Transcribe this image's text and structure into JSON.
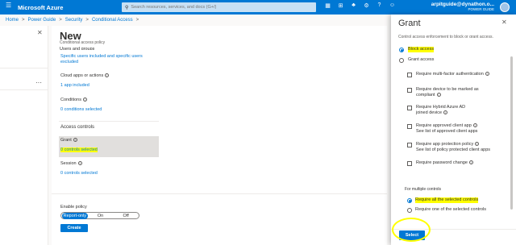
{
  "topbar": {
    "brand": "Microsoft Azure",
    "search_placeholder": "Search resources, services, and docs (G+/)",
    "user_name": "arpitguide@dynathon.o...",
    "user_dir": "POWER GUIDE"
  },
  "breadcrumb": [
    "Home",
    "Power Guide",
    "Security",
    "Conditional Access"
  ],
  "new_panel": {
    "title": "New",
    "subtitle": "Conditional access policy",
    "users_link": "Specific users included and specific users excluded",
    "cloud_apps_label": "Cloud apps or actions",
    "cloud_apps_value": "1 app included",
    "conditions_label": "Conditions",
    "conditions_value": "0 conditions selected",
    "access_controls_heading": "Access controls",
    "grant_label": "Grant",
    "grant_value": "0 controls selected",
    "session_label": "Session",
    "session_value": "0 controls selected",
    "enable_policy_label": "Enable policy",
    "toggle_options": [
      "Report-only",
      "On",
      "Off"
    ],
    "toggle_selected": "Report-only",
    "create_label": "Create"
  },
  "grant_panel": {
    "title": "Grant",
    "block_access": "Block access",
    "grant_access": "Grant access",
    "options": [
      {
        "label": "Require multi-factor authentication"
      },
      {
        "label": "Require device to be marked as compliant"
      },
      {
        "label": "Require Hybrid Azure AD joined device"
      },
      {
        "label": "Require approved client app",
        "link": "See list of approved client apps"
      },
      {
        "label": "Require app protection policy",
        "link": "See list of policy protected client apps"
      },
      {
        "label": "Require password change"
      }
    ],
    "multiple_controls_label": "For multiple controls",
    "require_all": "Require all the selected controls",
    "require_one": "Require one of the selected controls",
    "select_label": "Select"
  },
  "colors": {
    "accent": "#0078d4",
    "highlight": "#ffff00"
  }
}
